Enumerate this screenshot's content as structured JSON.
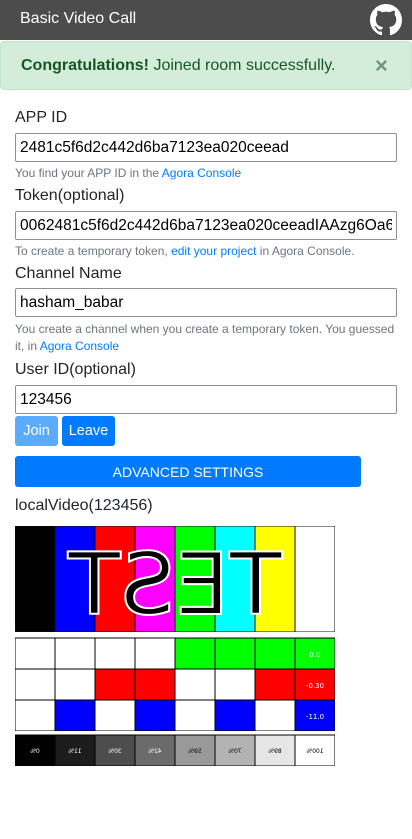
{
  "navbar": {
    "title": "Basic Video Call",
    "github_icon": "github-icon"
  },
  "alert": {
    "strong": "Congratulations!",
    "message": " Joined room successfully.",
    "close": "×",
    "background": "#d4edda",
    "text_color": "#155724"
  },
  "form": {
    "app_id": {
      "label": "APP ID",
      "value": "2481c5f6d2c442d6ba7123ea020ceead",
      "help_prefix": "You find your APP ID in the ",
      "help_link": "Agora Console"
    },
    "token": {
      "label": "Token(optional)",
      "value": "0062481c5f6d2c442d6ba7123ea020ceeadIAAzg6Oa6",
      "help_prefix": "To create a temporary token, ",
      "help_link": "edit your project",
      "help_suffix": " in Agora Console."
    },
    "channel": {
      "label": "Channel Name",
      "value": "hasham_babar",
      "help_prefix": "You create a channel when you create a temporary token. You guessed it, in ",
      "help_link": "Agora Console"
    },
    "uid": {
      "label": "User ID(optional)",
      "value": "123456"
    }
  },
  "buttons": {
    "join": "Join",
    "leave": "Leave",
    "advanced": "ADVANCED SETTINGS"
  },
  "video": {
    "label": "localVideo(123456)",
    "test_text": "TEST",
    "top_bar_colors": [
      "#000000",
      "#0000ff",
      "#ff0000",
      "#ff00ff",
      "#00ff00",
      "#00ffff",
      "#ffff00",
      "#ffffff"
    ],
    "grid_rows": [
      [
        "#ffffff",
        "#ffffff",
        "#ffffff",
        "#ffffff",
        "#00ff00",
        "#00ff00",
        "#00ff00",
        "#00ff00"
      ],
      [
        "#ffffff",
        "#ffffff",
        "#ff0000",
        "#ff0000",
        "#ffffff",
        "#ffffff",
        "#ff0000",
        "#ff0000"
      ],
      [
        "#ffffff",
        "#0000ff",
        "#ffffff",
        "#0000ff",
        "#ffffff",
        "#0000ff",
        "#ffffff",
        "#0000ff"
      ]
    ],
    "grid_labels": [
      "0.0",
      "-0.30",
      "-11.0"
    ],
    "gray_levels": [
      "#000000",
      "#1c1c1c",
      "#4d4d4d",
      "#6b6b6b",
      "#999999",
      "#b3b3b3",
      "#e6e6e6",
      "#ffffff"
    ],
    "gray_labels": [
      "0%",
      "11%",
      "30%",
      "42%",
      "59%",
      "70%",
      "89%",
      "100%"
    ]
  }
}
